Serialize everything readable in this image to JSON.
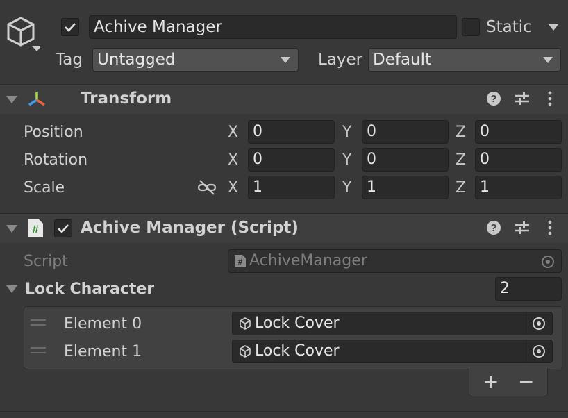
{
  "header": {
    "object_name": "Achive Manager",
    "static_label": "Static",
    "tag_label": "Tag",
    "tag_value": "Untagged",
    "layer_label": "Layer",
    "layer_value": "Default",
    "active_checked": true,
    "static_checked": false
  },
  "transform": {
    "title": "Transform",
    "rows": [
      {
        "label": "Position",
        "x": "0",
        "y": "0",
        "z": "0"
      },
      {
        "label": "Rotation",
        "x": "0",
        "y": "0",
        "z": "0"
      },
      {
        "label": "Scale",
        "x": "1",
        "y": "1",
        "z": "1"
      }
    ],
    "axis_labels": [
      "X",
      "Y",
      "Z"
    ]
  },
  "script_component": {
    "title": "Achive Manager (Script)",
    "enabled": true,
    "script_label": "Script",
    "script_value": "AchiveManager",
    "lock_label": "Lock Character",
    "lock_count": "2",
    "elements": [
      {
        "label": "Element 0",
        "value": "Lock Cover"
      },
      {
        "label": "Element 1",
        "value": "Lock Cover"
      }
    ],
    "add_symbol": "+",
    "remove_symbol": "−"
  },
  "icons": {
    "gameobject": "cube-icon",
    "transform": "transform-axis-icon",
    "script": "csharp-script-icon",
    "help": "help-icon",
    "presets": "sliders-icon",
    "menu": "kebab-menu-icon",
    "link": "unlinked-chain-icon",
    "object_picker": "target-icon"
  },
  "colors": {
    "background": "#383838",
    "field": "#2a2a2a",
    "header": "#3e3e3e"
  }
}
